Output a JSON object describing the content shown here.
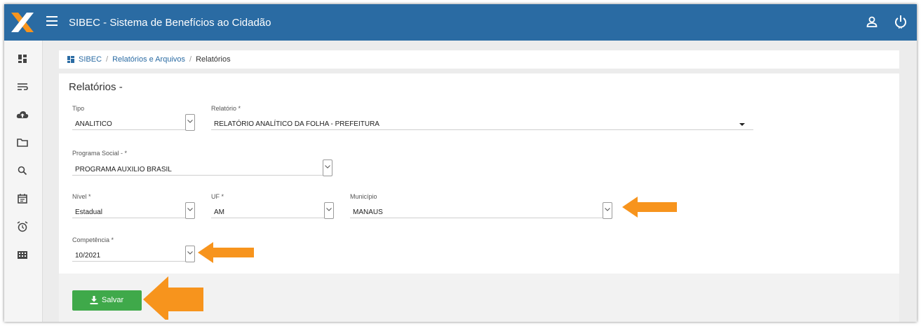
{
  "header": {
    "title": "SIBEC - Sistema de Benefícios ao Cidadão"
  },
  "sidebar": {
    "icons": [
      "dashboard-icon",
      "list-wrap-icon",
      "cloud-upload-icon",
      "folder-icon",
      "search-icon",
      "calendar-icon",
      "alarm-icon",
      "building-icon"
    ]
  },
  "breadcrumb": {
    "items": [
      "SIBEC",
      "Relatórios e Arquivos",
      "Relatórios"
    ]
  },
  "form": {
    "title": "Relatórios -",
    "tipo": {
      "label": "Tipo",
      "value": "ANALITICO"
    },
    "relatorio": {
      "label": "Relatório *",
      "value": "RELATÓRIO ANALÍTICO DA FOLHA - PREFEITURA"
    },
    "programa": {
      "label": "Programa Social - *",
      "value": "PROGRAMA AUXILIO BRASIL"
    },
    "nivel": {
      "label": "Nível *",
      "value": "Estadual"
    },
    "uf": {
      "label": "UF *",
      "value": "AM"
    },
    "municipio": {
      "label": "Município",
      "value": "MANAUS"
    },
    "competencia": {
      "label": "Competência *",
      "value": "10/2021"
    }
  },
  "actions": {
    "save_label": "Salvar"
  },
  "colors": {
    "header": "#2a6ba3",
    "save": "#3fa94a",
    "arrow": "#f7941d"
  }
}
